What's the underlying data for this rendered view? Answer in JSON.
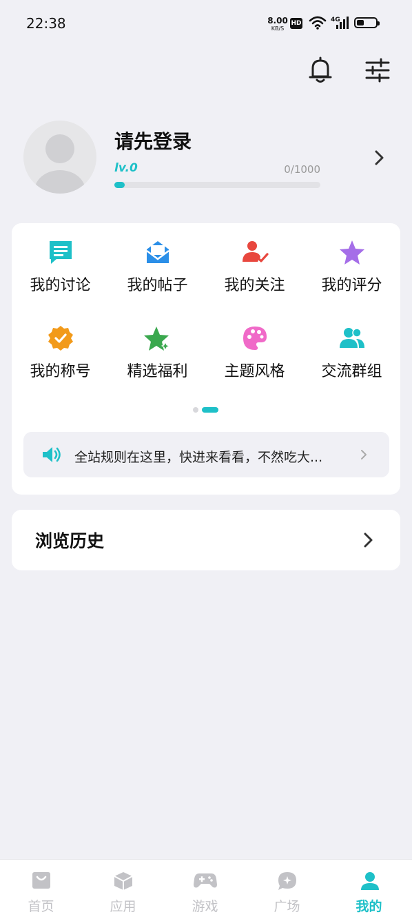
{
  "status_bar": {
    "time": "22:38",
    "net_speed": "8.00",
    "net_unit": "KB/S",
    "hd": "HD",
    "network_type": "4G",
    "battery_level": 0.4
  },
  "profile": {
    "name": "请先登录",
    "level": "lv.0",
    "xp_text": "0/1000",
    "xp_progress": 0.05
  },
  "features": [
    {
      "label": "我的讨论",
      "icon": "chat-icon",
      "color": "#1ec0c8"
    },
    {
      "label": "我的帖子",
      "icon": "mail-icon",
      "color": "#2b8fe8"
    },
    {
      "label": "我的关注",
      "icon": "user-check-icon",
      "color": "#e8473e"
    },
    {
      "label": "我的评分",
      "icon": "star-icon",
      "color": "#a56ee8"
    },
    {
      "label": "我的称号",
      "icon": "badge-check-icon",
      "color": "#f29a1a"
    },
    {
      "label": "精选福利",
      "icon": "star-sparkle-icon",
      "color": "#3aa84e"
    },
    {
      "label": "主题风格",
      "icon": "palette-icon",
      "color": "#f06ac8"
    },
    {
      "label": "交流群组",
      "icon": "group-icon",
      "color": "#1ec0c8"
    }
  ],
  "pager": {
    "total": 2,
    "active": 1
  },
  "notice": {
    "text": "全站规则在这里，快进来看看，不然吃大..."
  },
  "history": {
    "label": "浏览历史"
  },
  "tabs": [
    {
      "label": "首页",
      "icon": "home-bag-icon",
      "active": false
    },
    {
      "label": "应用",
      "icon": "app-cube-icon",
      "active": false
    },
    {
      "label": "游戏",
      "icon": "gamepad-icon",
      "active": false
    },
    {
      "label": "广场",
      "icon": "chat-star-icon",
      "active": false
    },
    {
      "label": "我的",
      "icon": "person-icon",
      "active": true
    }
  ],
  "colors": {
    "accent": "#1ec0c8",
    "inactive": "#c2c2c6",
    "background": "#f0f0f5"
  }
}
